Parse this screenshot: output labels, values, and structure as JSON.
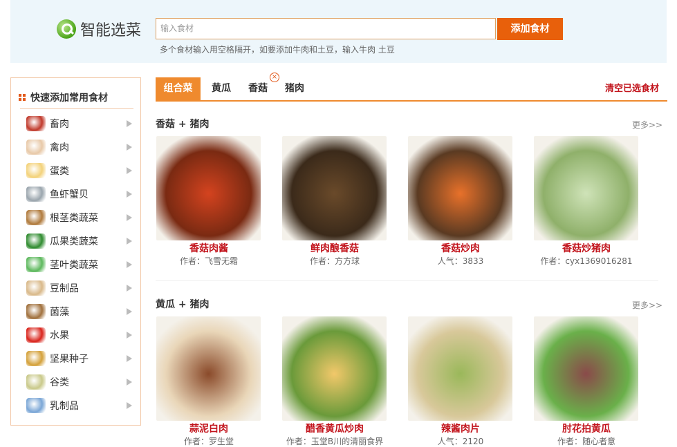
{
  "header": {
    "logo_text": "智能选菜",
    "search_placeholder": "输入食材",
    "add_button": "添加食材",
    "hint": "多个食材输入用空格隔开，如要添加牛肉和土豆，输入牛肉 土豆"
  },
  "sidebar": {
    "title": "快速添加常用食材",
    "items": [
      {
        "label": "畜肉",
        "icon": "meat-icon",
        "color": "#c0392b"
      },
      {
        "label": "禽肉",
        "icon": "poultry-icon",
        "color": "#e8c9a8"
      },
      {
        "label": "蛋类",
        "icon": "egg-icon",
        "color": "#f3d27a"
      },
      {
        "label": "鱼虾蟹贝",
        "icon": "fish-icon",
        "color": "#9aa5ad"
      },
      {
        "label": "根茎类蔬菜",
        "icon": "potato-icon",
        "color": "#b07a3c"
      },
      {
        "label": "瓜果类蔬菜",
        "icon": "cucumber-icon",
        "color": "#2e8b2e"
      },
      {
        "label": "茎叶类蔬菜",
        "icon": "leafy-greens-icon",
        "color": "#5cb85c"
      },
      {
        "label": "豆制品",
        "icon": "tofu-icon",
        "color": "#d9b98a"
      },
      {
        "label": "菌藻",
        "icon": "mushroom-icon",
        "color": "#a0703c"
      },
      {
        "label": "水果",
        "icon": "apple-icon",
        "color": "#d9231b"
      },
      {
        "label": "坚果种子",
        "icon": "nuts-icon",
        "color": "#d4a13a"
      },
      {
        "label": "谷类",
        "icon": "grain-bowl-icon",
        "color": "#c9c98a"
      },
      {
        "label": "乳制品",
        "icon": "milk-icon",
        "color": "#7aa6d6"
      }
    ]
  },
  "tabs": {
    "items": [
      "组合菜",
      "黄瓜",
      "香菇",
      "猪肉"
    ],
    "close_glyph": "×",
    "clear_label": "清空已选食材"
  },
  "sections": [
    {
      "title": "香菇 + 猪肉",
      "more": "更多>>",
      "cards": [
        {
          "name": "香菇肉酱",
          "meta": "作者：飞雪无霜",
          "colors": [
            "#d4431f",
            "#7a2a12"
          ]
        },
        {
          "name": "鲜肉酿香菇",
          "meta": "作者：方方球",
          "colors": [
            "#6a4a2a",
            "#3b2a1a"
          ]
        },
        {
          "name": "香菇炒肉",
          "meta": "人气：3833",
          "colors": [
            "#e8712a",
            "#5a3a22"
          ]
        },
        {
          "name": "香菇炒猪肉",
          "meta": "作者：cyx1369016281",
          "colors": [
            "#cfe3b8",
            "#8fb06a"
          ]
        }
      ]
    },
    {
      "title": "黄瓜 + 猪肉",
      "more": "更多>>",
      "cards": [
        {
          "name": "蒜泥白肉",
          "meta": "作者：罗生堂",
          "colors": [
            "#8a4a2a",
            "#e9d6b8"
          ]
        },
        {
          "name": "醋香黄瓜炒肉",
          "meta": "作者：玉堂B川的清丽食界",
          "colors": [
            "#f2c86a",
            "#6a9a3a"
          ]
        },
        {
          "name": "辣酱肉片",
          "meta": "人气：2120",
          "colors": [
            "#9ab85a",
            "#d8c89a"
          ]
        },
        {
          "name": "肘花拍黄瓜",
          "meta": "作者：随心者意",
          "colors": [
            "#8a4a4a",
            "#6ab04a"
          ]
        }
      ]
    }
  ]
}
